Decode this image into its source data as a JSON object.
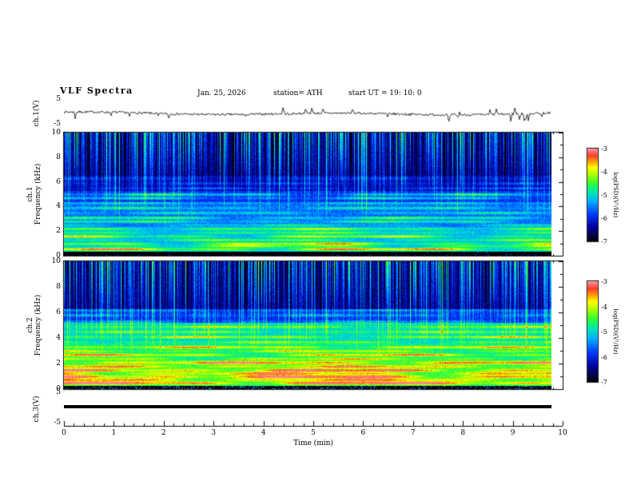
{
  "header": {
    "title": "VLF  Spectra",
    "date": "Jan. 25, 2026",
    "station": "station= ATH",
    "start_ut": "start UT =  19: 10: 0"
  },
  "x_axis": {
    "label": "Time (min)",
    "ticks": [
      "0",
      "1",
      "2",
      "3",
      "4",
      "5",
      "6",
      "7",
      "8",
      "9",
      "10"
    ]
  },
  "panels": {
    "ch1_wave": {
      "ylabel": "ch.1(V)",
      "yticks": [
        "5",
        "-5"
      ]
    },
    "ch1_spec": {
      "ylabel_line1": "ch.1",
      "ylabel_line2": "Frequency (kHz)",
      "yticks": [
        "10",
        "8",
        "6",
        "4",
        "2",
        "0"
      ]
    },
    "ch2_spec": {
      "ylabel_line1": "ch.2",
      "ylabel_line2": "Frequency (kHz)",
      "yticks": [
        "10",
        "8",
        "6",
        "4",
        "2",
        "0"
      ]
    },
    "ch3_wave": {
      "ylabel": "ch.3(V)",
      "yticks": [
        "5",
        "-5"
      ]
    }
  },
  "colorbar": {
    "label": "log(PSD)(V²/Hz)",
    "ticks": [
      "-3",
      "-4",
      "-5",
      "-6",
      "-7"
    ]
  },
  "chart_data": {
    "type": "heatmap",
    "title": "VLF Spectra",
    "subtitle": "Jan. 25, 2026  station= ATH  start UT = 19:10:0",
    "x": {
      "label": "Time (min)",
      "range": [
        0,
        10
      ],
      "ticks": [
        0,
        1,
        2,
        3,
        4,
        5,
        6,
        7,
        8,
        9,
        10
      ],
      "data_end_min": 9.8
    },
    "panels": [
      {
        "id": "ch1_voltage",
        "type": "line",
        "ylabel": "ch.1(V)",
        "ylim": [
          -5,
          5
        ],
        "summary": "broadband noise trace fluctuating around 0 V with intermittent impulsive spikes of a few volts"
      },
      {
        "id": "ch1_spectrogram",
        "type": "heatmap",
        "ylabel": "ch.1 Frequency (kHz)",
        "ylim": [
          0,
          10
        ],
        "yticks": [
          0,
          2,
          4,
          6,
          8,
          10
        ],
        "intensity_scale": {
          "label": "log(PSD)(V²/Hz)",
          "range": [
            -7,
            -3
          ]
        },
        "persistent_bands_khz": [
          [
            0.55,
            1.6
          ],
          [
            0.8,
            1.0
          ],
          [
            1.0,
            1.4
          ],
          [
            1.3,
            0.9
          ],
          [
            1.6,
            1.2
          ],
          [
            1.9,
            0.8
          ],
          [
            2.2,
            1.0
          ],
          [
            2.5,
            0.7
          ],
          [
            2.8,
            0.9
          ],
          [
            3.1,
            1.0
          ],
          [
            3.5,
            0.6
          ],
          [
            3.9,
            0.7
          ],
          [
            4.3,
            0.5
          ],
          [
            4.7,
            0.9
          ],
          [
            5.0,
            1.0
          ],
          [
            5.5,
            0.5
          ],
          [
            5.9,
            0.4
          ],
          [
            6.3,
            0.3
          ]
        ],
        "features": [
          "dense vertical sferic streaks above ~5 kHz on dark-blue background",
          "horizontal interference lines below ~5 kHz",
          "quiet (black) band below ~0.4 kHz"
        ]
      },
      {
        "id": "ch2_spectrogram",
        "type": "heatmap",
        "ylabel": "ch.2 Frequency (kHz)",
        "ylim": [
          0,
          10
        ],
        "yticks": [
          0,
          2,
          4,
          6,
          8,
          10
        ],
        "intensity_scale": {
          "label": "log(PSD)(V²/Hz)",
          "range": [
            -7,
            -3
          ]
        },
        "persistent_bands_khz": [
          [
            0.5,
            1.9
          ],
          [
            0.75,
            1.3
          ],
          [
            1.0,
            1.8
          ],
          [
            1.25,
            1.2
          ],
          [
            1.5,
            1.6
          ],
          [
            1.8,
            1.1
          ],
          [
            2.1,
            1.4
          ],
          [
            2.4,
            1.0
          ],
          [
            2.7,
            1.3
          ],
          [
            3.0,
            0.9
          ],
          [
            3.3,
            1.1
          ],
          [
            3.7,
            0.8
          ],
          [
            4.1,
            1.0
          ],
          [
            4.5,
            0.7
          ],
          [
            4.9,
            0.8
          ],
          [
            5.3,
            0.6
          ],
          [
            5.8,
            0.5
          ],
          [
            6.2,
            0.4
          ]
        ],
        "features": [
          "strong green/yellow broadband power below ~5 kHz with red interference lines",
          "vertical sferic streaks above ~6 kHz",
          "speckled quiet band below ~0.3 kHz"
        ]
      },
      {
        "id": "ch3_voltage",
        "type": "line",
        "ylabel": "ch.3(V)",
        "ylim": [
          -5,
          5
        ],
        "summary": "constant flat thick line at ~0 V (channel inactive)"
      }
    ]
  }
}
